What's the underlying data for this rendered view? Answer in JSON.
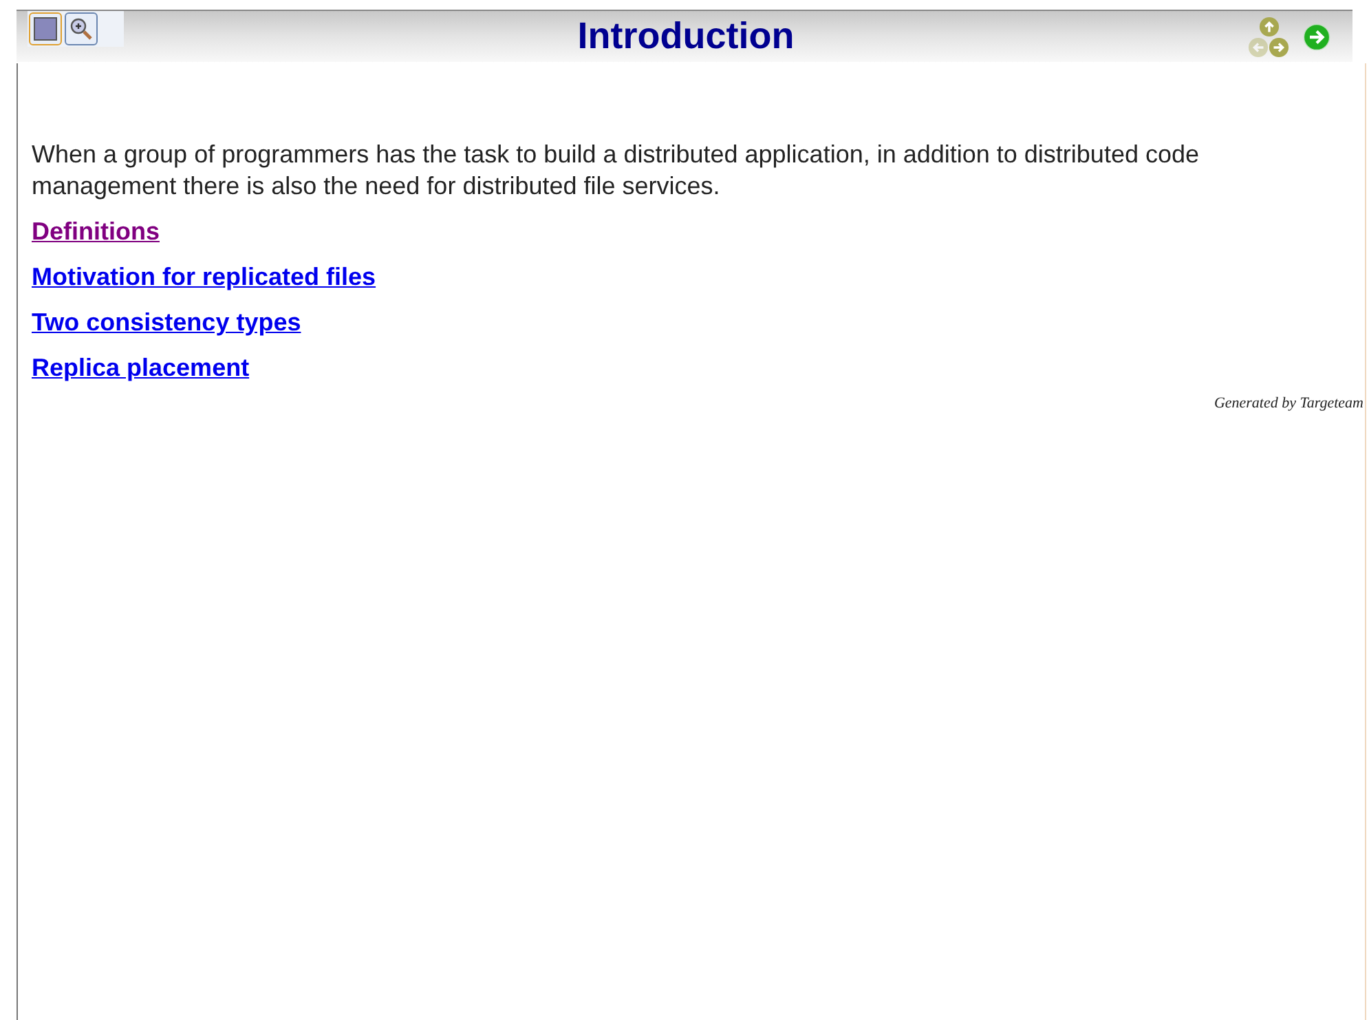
{
  "tools": [
    {
      "kind": "frame",
      "selected": true
    },
    {
      "kind": "zoom",
      "selected": false
    }
  ],
  "title": "Introduction",
  "nav": [
    {
      "kind": "up",
      "disabled": false
    },
    {
      "kind": "left",
      "disabled": true
    },
    {
      "kind": "right",
      "disabled": false
    }
  ],
  "intro": "When a group of programmers has the task to build a distributed application, in addition to distributed code management there is also the need for distributed file services.",
  "links": [
    {
      "label": "Definitions",
      "visited": true
    },
    {
      "label": "Motivation for replicated files",
      "visited": false
    },
    {
      "label": "Two consistency types",
      "visited": false
    },
    {
      "label": "Replica placement",
      "visited": false
    }
  ],
  "footer": "Generated by Targeteam"
}
